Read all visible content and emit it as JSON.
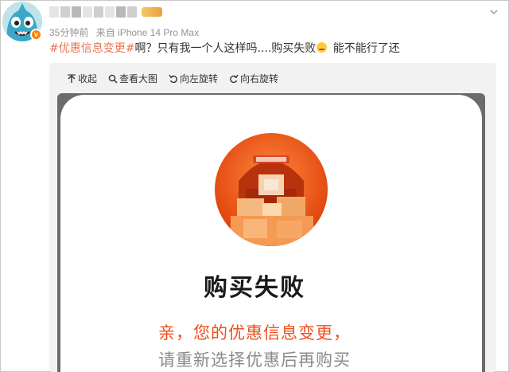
{
  "post": {
    "time": "35分钟前",
    "source": "来自 iPhone 14 Pro Max",
    "hashtag": "#优惠信息变更#",
    "text": "啊？只有我一个人这样吗....购买失败",
    "text_after_emoji": " 能不能行了还",
    "avatar_badge": "v"
  },
  "toolbar": {
    "collapse": "收起",
    "view_large": "查看大图",
    "rotate_left": "向左旋转",
    "rotate_right": "向右旋转"
  },
  "image": {
    "title": "购买失败",
    "line1": "亲，您的优惠信息变更，",
    "line2": "请重新选择优惠后再购买"
  },
  "colors": {
    "hashtag": "#eb7350",
    "accent": "#ff8200",
    "error_text": "#f04e1c"
  },
  "icons": [
    "collapse-icon",
    "magnifier-icon",
    "rotate-left-icon",
    "rotate-right-icon",
    "chevron-down-icon",
    "emoji-icon"
  ]
}
